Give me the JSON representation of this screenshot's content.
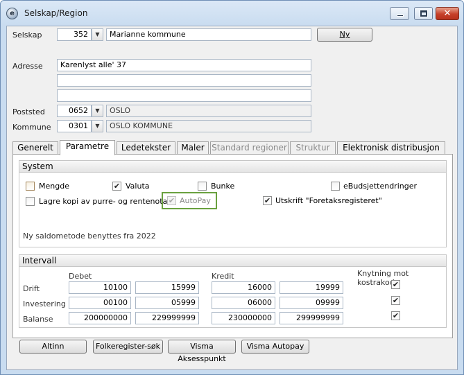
{
  "window": {
    "title": "Selskap/Region",
    "icon": "app-logo-icon"
  },
  "company": {
    "label": "Selskap",
    "code": "352",
    "name": "Marianne kommune",
    "new_button": "Ny"
  },
  "address": {
    "label": "Adresse",
    "line1": "Karenlyst alle' 37",
    "line2": "",
    "line3": ""
  },
  "postal": {
    "label": "Poststed",
    "code": "0652",
    "name": "OSLO"
  },
  "municipality": {
    "label": "Kommune",
    "code": "0301",
    "name": "OSLO KOMMUNE"
  },
  "tabs": [
    {
      "label": "Generelt",
      "state": "normal"
    },
    {
      "label": "Parametre",
      "state": "active"
    },
    {
      "label": "Ledetekster",
      "state": "normal"
    },
    {
      "label": "Maler",
      "state": "normal"
    },
    {
      "label": "Standard regioner",
      "state": "disabled"
    },
    {
      "label": "Struktur",
      "state": "disabled"
    },
    {
      "label": "Elektronisk distribusjon",
      "state": "normal"
    }
  ],
  "system": {
    "heading": "System",
    "checkboxes": [
      {
        "label": "Mengde",
        "checked": false
      },
      {
        "label": "Valuta",
        "checked": true
      },
      {
        "label": "Bunke",
        "checked": false
      },
      {
        "label": "eBudsjettendringer",
        "checked": false
      },
      {
        "label": "Lagre kopi av purre- og rentenota",
        "checked": false
      },
      {
        "label": "AutoPay",
        "checked": true,
        "disabled": true
      },
      {
        "label": "Utskrift \"Foretaksregisteret\"",
        "checked": true
      }
    ],
    "saldo_note": "Ny saldometode benyttes fra 2022"
  },
  "interval": {
    "heading": "Intervall",
    "debet_label": "Debet",
    "kredit_label": "Kredit",
    "knytning_label": "Knytning mot kostrakode",
    "rows": [
      {
        "label": "Drift",
        "debet_from": "10100",
        "debet_to": "15999",
        "kredit_from": "16000",
        "kredit_to": "19999",
        "knytning": true
      },
      {
        "label": "Investering",
        "debet_from": "00100",
        "debet_to": "05999",
        "kredit_from": "06000",
        "kredit_to": "09999",
        "knytning": true
      },
      {
        "label": "Balanse",
        "debet_from": "200000000",
        "debet_to": "229999999",
        "kredit_from": "230000000",
        "kredit_to": "299999999",
        "knytning": true
      }
    ]
  },
  "buttons": {
    "altinn": "Altinn",
    "folkeregister": "Folkeregister-søk",
    "visma_aksesspunkt": "Visma Aksesspunkt",
    "visma_autopay": "Visma Autopay"
  },
  "colors": {
    "highlight": "#6aa13f",
    "window_frame": "#c9dcf0",
    "close_button": "#c6402a"
  }
}
